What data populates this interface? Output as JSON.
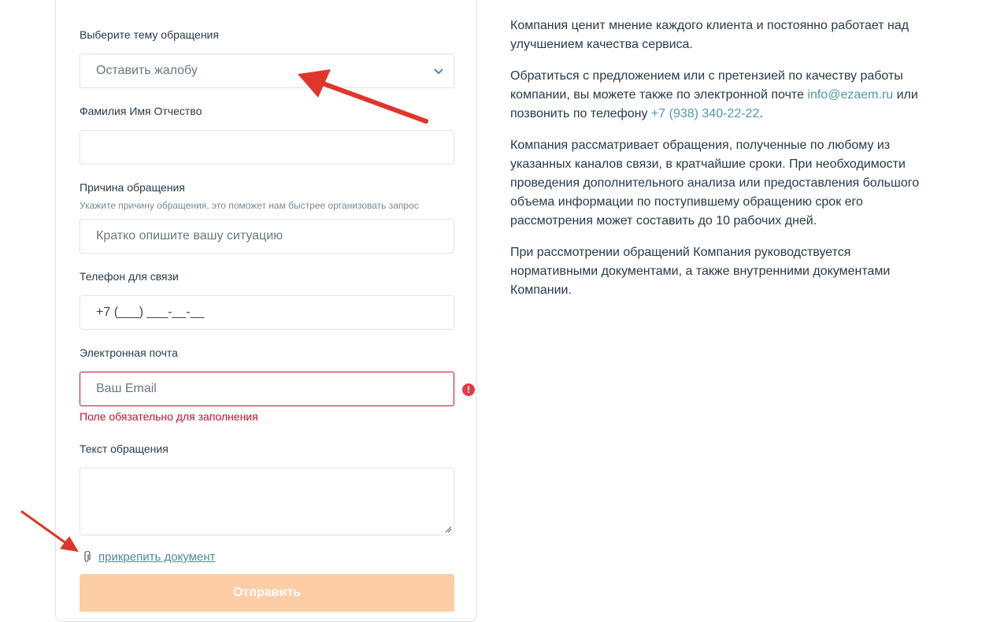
{
  "form": {
    "topic_label": "Выберите тему обращения",
    "topic_value": "Оставить жалобу",
    "fio_label": "Фамилия Имя Отчество",
    "fio_value": "",
    "reason_label": "Причина обращения",
    "reason_hint": "Укажите причину обращения, это поможет нам быстрее организовать запрос",
    "reason_placeholder": "Кратко опишите вашу ситуацию",
    "phone_label": "Телефон для связи",
    "phone_value": "+7 (___) ___-__-__",
    "email_label": "Электронная почта",
    "email_placeholder": "Ваш Email",
    "email_error": "Поле обязательно для заполнения",
    "text_label": "Текст обращения",
    "attach_label": "прикрепить документ",
    "submit_label": "Отправить"
  },
  "info": {
    "p1": "Компания ценит мнение каждого клиента и постоянно работает над улучшением качества сервиса.",
    "p2_before": "Обратиться с предложением или с претензией по качеству работы компании, вы можете также по электронной почте ",
    "p2_email": "info@ezaem.ru",
    "p2_middle": " или позвонить по телефону ",
    "p2_phone": "+7 (938) 340-22-22",
    "p2_after": ".",
    "p3": "Компания рассматривает обращения, полученные по любому из указанных каналов связи, в кратчайшие сроки. При необходимости проведения дополнительного анализа или предоставления большого объема информации по поступившему обращению срок его рассмотрения может составить до 10 рабочих дней.",
    "p4": "При рассмотрении обращений Компания руководствуется нормативными документами, а также внутренними документами Компании."
  },
  "colors": {
    "error": "#c8102e",
    "link": "#4f9aa5",
    "submit_bg": "#fdcea6",
    "annotation_arrow": "#e0352b"
  },
  "icons": [
    "chevron-down-icon",
    "error-icon",
    "paperclip-icon"
  ]
}
